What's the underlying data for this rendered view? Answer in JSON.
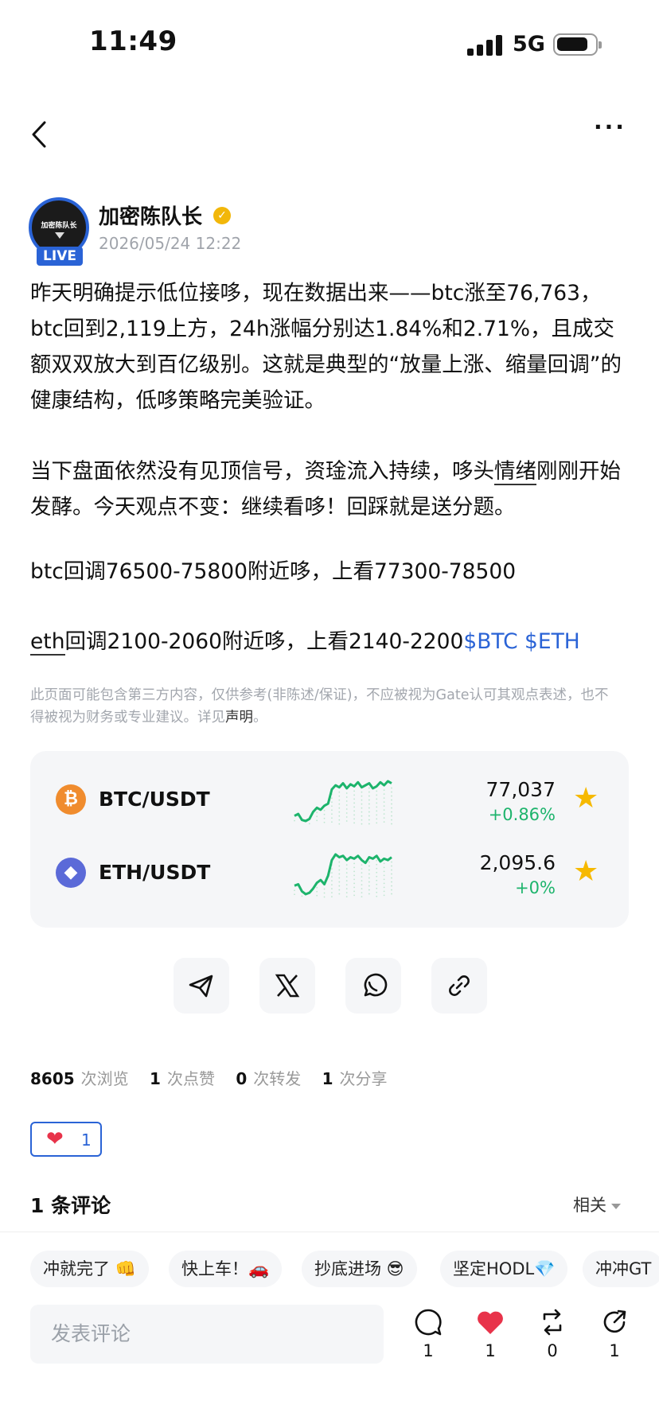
{
  "status_bar": {
    "time": "11:49",
    "network": "5G"
  },
  "nav": {
    "more_label": "···"
  },
  "author": {
    "name": "加密陈队长",
    "date": "2026/05/24 12:22",
    "live_label": "LIVE",
    "avatar_text": "加密陈队长"
  },
  "post": {
    "p1": "昨天明确提示低位接哆，现在数据出来——btc涨至76,763，btc回到2,119上方，24h涨幅分别达1.84%和2.71%，且成交额双双放大到百亿级别。这就是典型的“放量上涨、缩量回调”的健康结构，低哆策略完美验证。",
    "p2_a": "当下盘面依然没有见顶信号，资琻流入持续，哆头",
    "p2_b": "情绪",
    "p2_c": "刚刚开始发酵。今天观点不变：继续看哆！回踩就是送分题。",
    "p3": "btc回调76500-75800附近哆，上看77300-78500",
    "p4_a": "eth",
    "p4_b": "回调2100-2060附近哆，上看2140-2200",
    "tag_btc": "$BTC",
    "tag_eth": "$ETH"
  },
  "disclaimer": {
    "text": "此页面可能包含第三方内容，仅供参考(非陈述/保证)，不应被视为Gate认可其观点表述，也不得被视为财务或专业建议。详见",
    "link": "声明",
    "end": "。"
  },
  "market": [
    {
      "pair": "BTC/USDT",
      "price": "77,037",
      "change": "+0.86%",
      "icon": "₿",
      "color": "#f08c2e",
      "trend": [
        22,
        24,
        18,
        17,
        19,
        26,
        30,
        28,
        32,
        34,
        48,
        52,
        50,
        54,
        49,
        53,
        51,
        55,
        50,
        52,
        54,
        49,
        51,
        55,
        52,
        56,
        54
      ]
    },
    {
      "pair": "ETH/USDT",
      "price": "2,095.6",
      "change": "+0%",
      "icon": "◆",
      "color": "#5b6ad8",
      "trend": [
        26,
        27,
        22,
        20,
        21,
        24,
        28,
        30,
        27,
        33,
        44,
        48,
        46,
        47,
        44,
        46,
        45,
        47,
        44,
        42,
        46,
        45,
        47,
        43,
        45,
        44,
        46
      ]
    }
  ],
  "share": [
    "telegram-icon",
    "x-icon",
    "whatsapp-icon",
    "link-icon"
  ],
  "stats": {
    "views": "8605",
    "views_label": "次浏览",
    "likes": "1",
    "likes_label": "次点赞",
    "reposts": "0",
    "reposts_label": "次转发",
    "shares": "1",
    "shares_label": "次分享"
  },
  "reaction": {
    "heart_count": "1"
  },
  "comments": {
    "title": "1 条评论",
    "sort": "相关"
  },
  "quick_replies": [
    "冲就完了 👊",
    "快上车！🚗",
    "抄底进场 😎",
    "坚定HODL💎",
    "冲冲GT"
  ],
  "composer": {
    "placeholder": "发表评论"
  },
  "actions": {
    "comments": "1",
    "likes": "1",
    "reposts": "0",
    "shares": "1"
  },
  "colors": {
    "accent": "#2a63d6",
    "up": "#1db46c",
    "star": "#f6b900",
    "heart": "#e8334a"
  }
}
